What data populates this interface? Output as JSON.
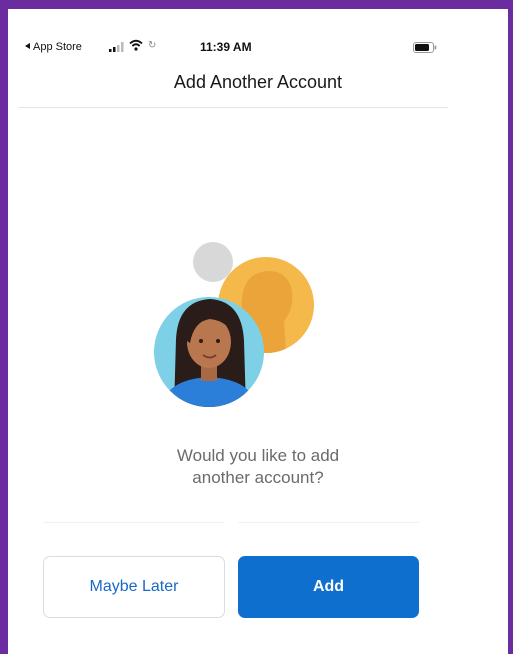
{
  "status_bar": {
    "back_label": "App Store",
    "time": "11:39 AM"
  },
  "header": {
    "title": "Add Another Account"
  },
  "illustration": {
    "icon": "people-avatars-illustration",
    "colors": {
      "person_bg": "#7ed0e6",
      "person_shirt": "#2c7fd8",
      "secondary_bg": "#f5b84a",
      "small_circle": "#d9d9d9"
    }
  },
  "prompt": {
    "line1": "Would you like to add",
    "line2": "another account?"
  },
  "buttons": {
    "maybe_later": "Maybe Later",
    "add": "Add"
  },
  "colors": {
    "accent": "#0f6fcf",
    "frame": "#6a2c9e"
  }
}
